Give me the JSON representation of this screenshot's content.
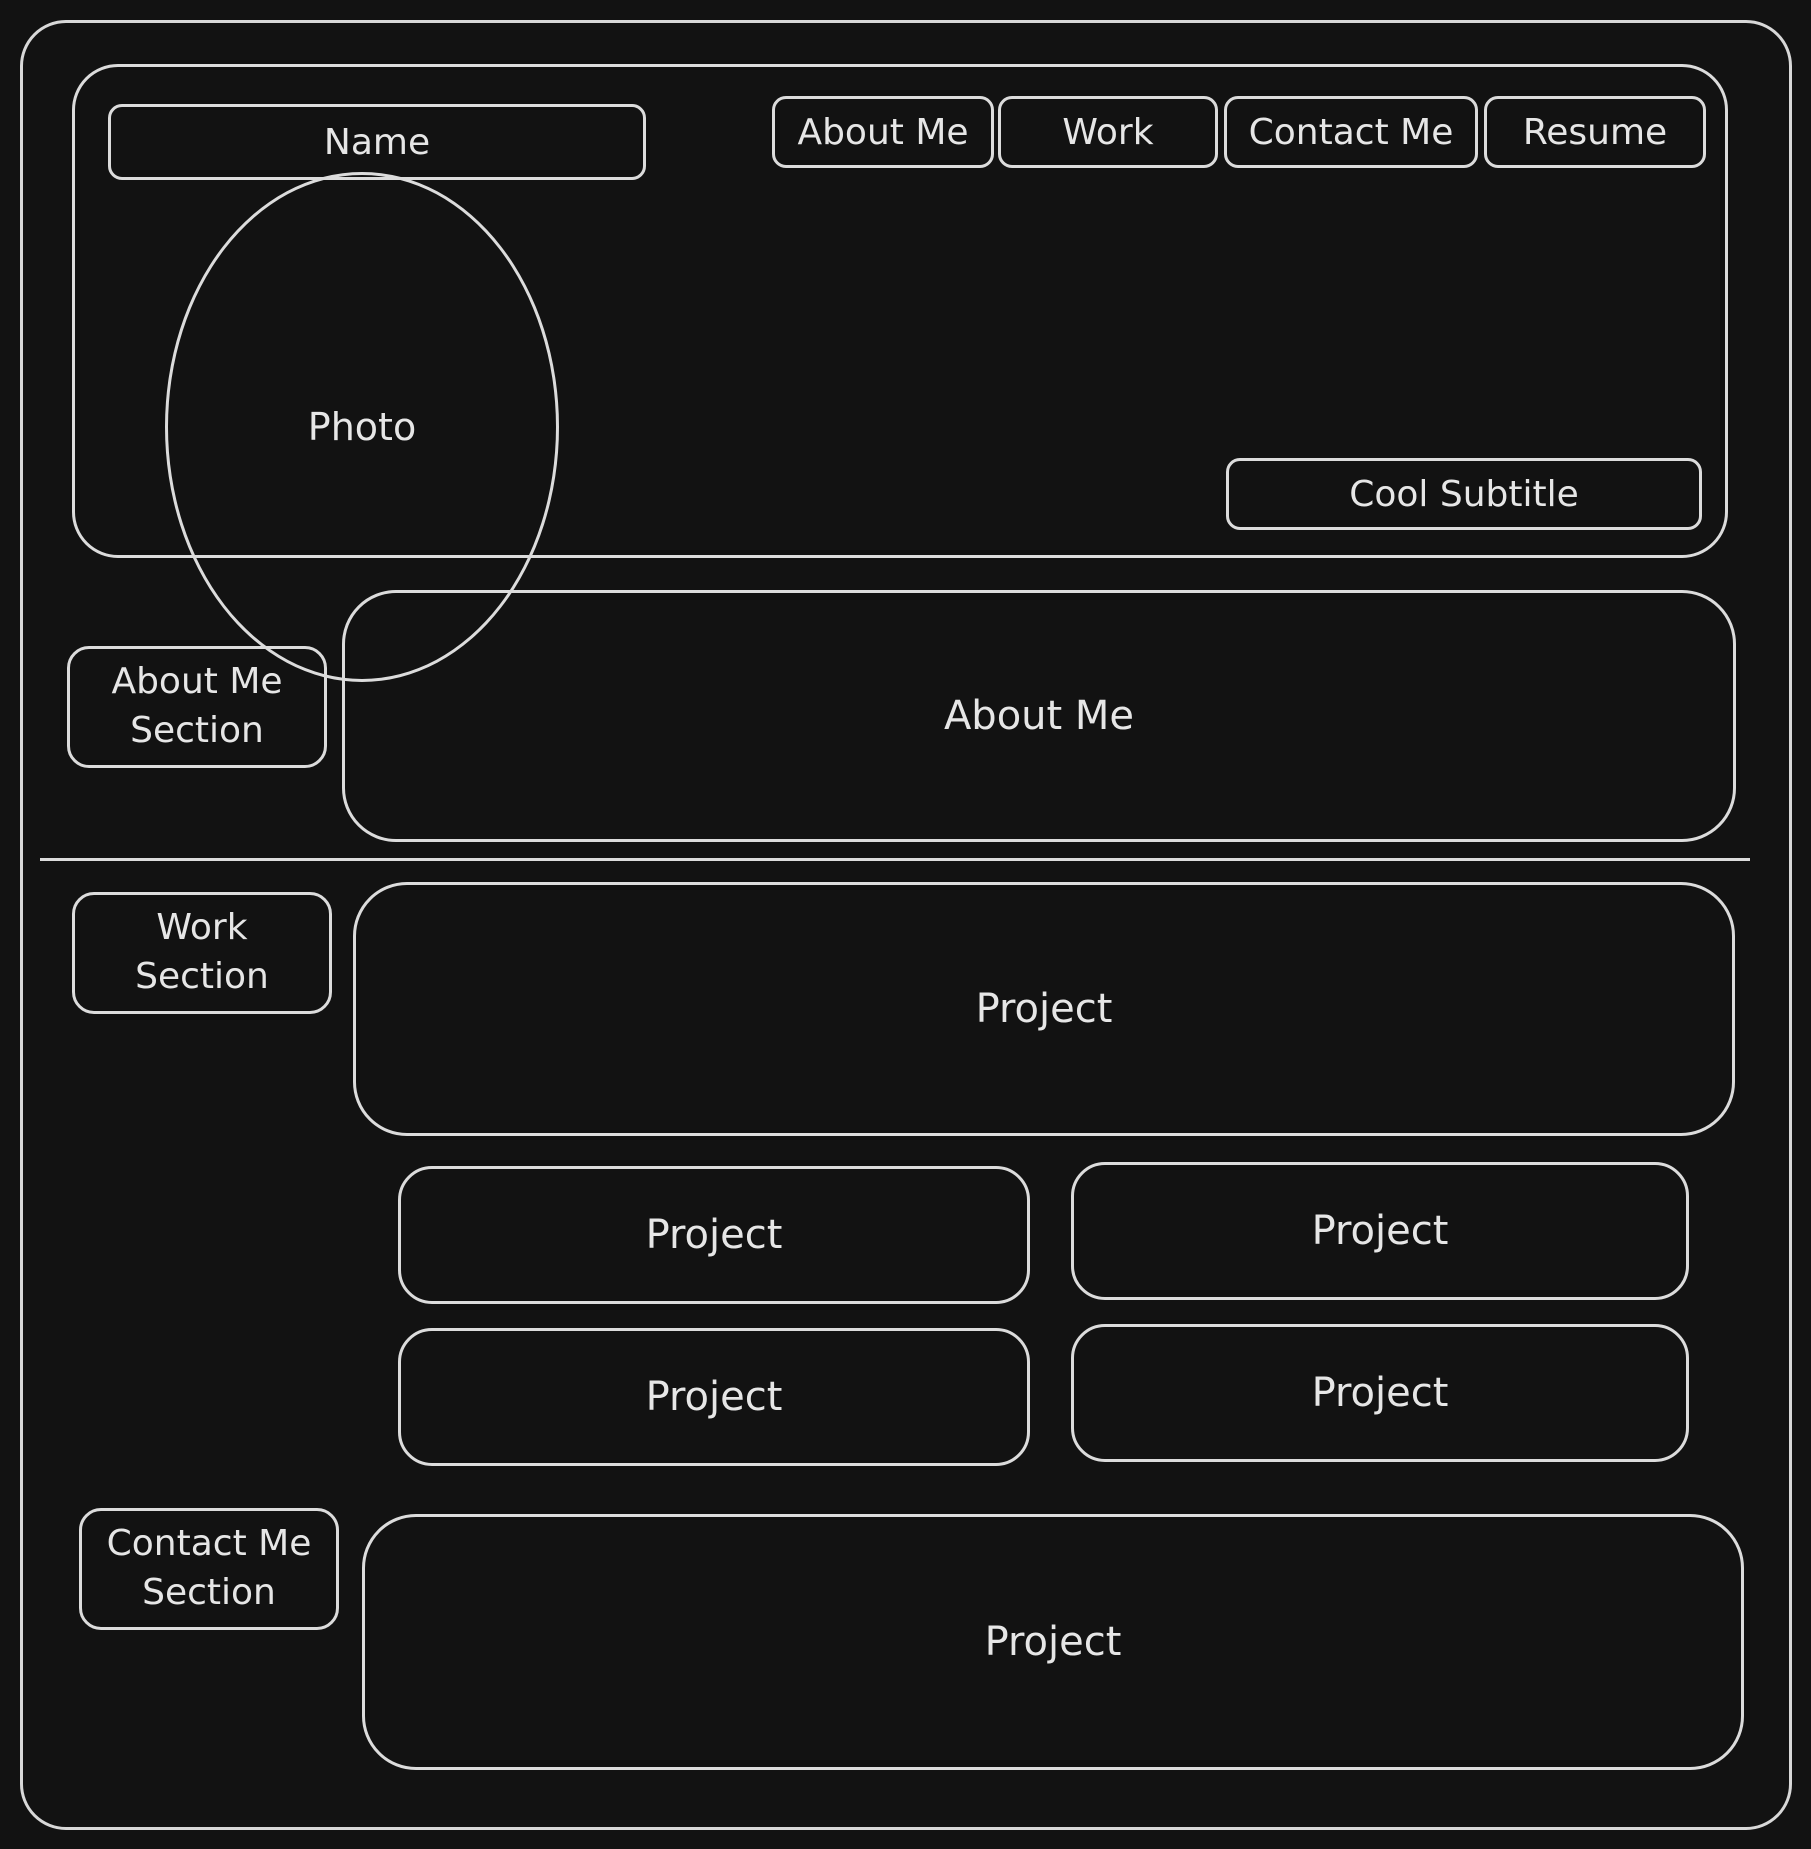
{
  "header": {
    "name": "Name",
    "photo": "Photo",
    "subtitle": "Cool Subtitle",
    "nav": [
      "About Me",
      "Work",
      "Contact Me",
      "Resume"
    ]
  },
  "about": {
    "section_label": "About Me\nSection",
    "panel_label": "About Me"
  },
  "work": {
    "section_label": "Work\nSection",
    "featured_label": "Project",
    "cards": [
      "Project",
      "Project",
      "Project",
      "Project"
    ]
  },
  "contact": {
    "section_label": "Contact Me\nSection",
    "panel_label": "Project"
  }
}
